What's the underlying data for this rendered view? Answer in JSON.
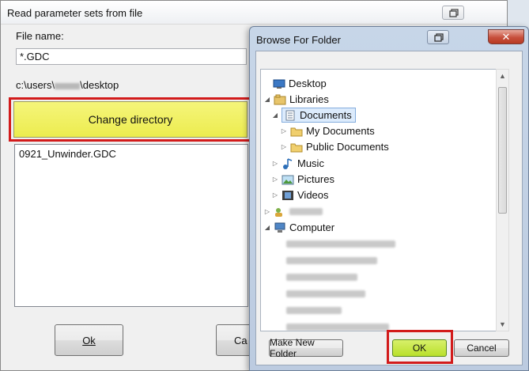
{
  "read_dialog": {
    "title": "Read parameter sets from file",
    "filename_label": "File name:",
    "filename_value": "*.GDC",
    "path_prefix": "c:\\users\\",
    "path_suffix": "\\desktop",
    "change_dir_label": "Change directory",
    "files": [
      "0921_Unwinder.GDC"
    ],
    "ok_label": "Ok",
    "cancel_label": "Ca"
  },
  "browse_dialog": {
    "title": "Browse For Folder",
    "tree": {
      "desktop": "Desktop",
      "libraries": "Libraries",
      "documents": "Documents",
      "my_documents": "My Documents",
      "public_documents": "Public Documents",
      "music": "Music",
      "pictures": "Pictures",
      "videos": "Videos",
      "computer": "Computer"
    },
    "make_folder_label": "Make New Folder",
    "ok_label": "OK",
    "cancel_label": "Cancel"
  },
  "colors": {
    "highlight_border": "#d21b1b",
    "change_dir_button": "#f0f05a",
    "ok_button": "#c6e63a"
  }
}
